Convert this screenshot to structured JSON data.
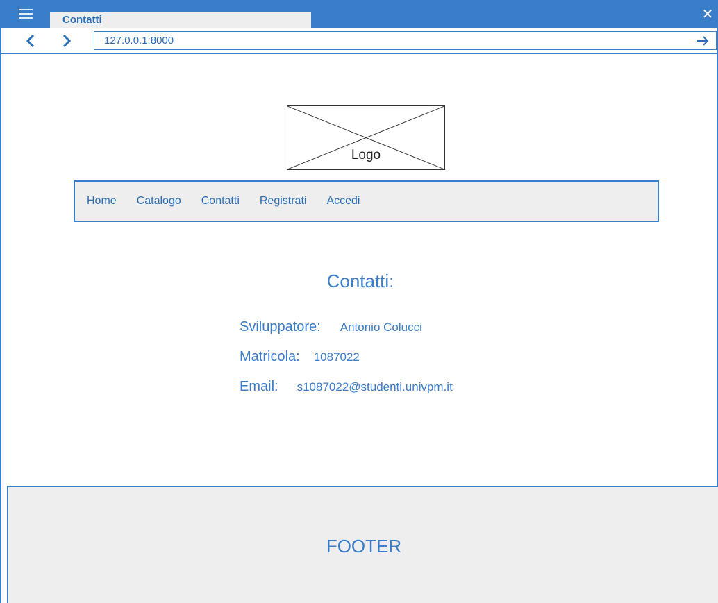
{
  "browser": {
    "tab_title": "Contatti",
    "url": "127.0.0.1:8000"
  },
  "logo": {
    "label": "Logo"
  },
  "nav": {
    "items": [
      {
        "label": "Home"
      },
      {
        "label": "Catalogo"
      },
      {
        "label": "Contatti"
      },
      {
        "label": "Registrati"
      },
      {
        "label": "Accedi"
      }
    ]
  },
  "main": {
    "heading": "Contatti:",
    "rows": [
      {
        "label": "Sviluppatore:",
        "value": "Antonio Colucci"
      },
      {
        "label": "Matricola:",
        "value": "1087022"
      },
      {
        "label": "Email:",
        "value": "s1087022@studenti.univpm.it"
      }
    ]
  },
  "footer": {
    "label": "FOOTER"
  },
  "colors": {
    "accent": "#3a7dc9",
    "panel": "#eeeeee"
  }
}
